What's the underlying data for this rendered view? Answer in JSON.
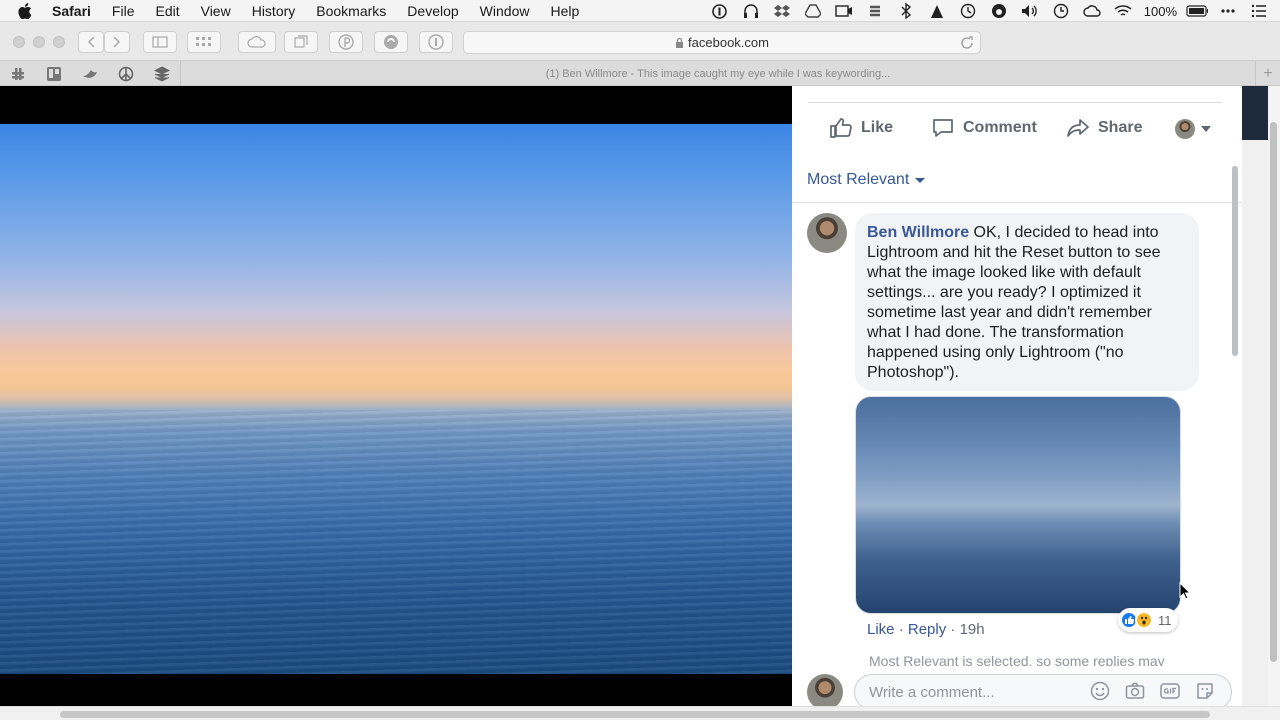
{
  "menubar": {
    "app": "Safari",
    "items": [
      "File",
      "Edit",
      "View",
      "History",
      "Bookmarks",
      "Develop",
      "Window",
      "Help"
    ],
    "battery": "100%"
  },
  "toolbar": {
    "url": "facebook.com"
  },
  "tab": {
    "title": "(1) Ben Willmore - This image caught my eye while I was keywording...",
    "new_tab": "+"
  },
  "post_actions": {
    "like": "Like",
    "comment": "Comment",
    "share": "Share"
  },
  "comments": {
    "sort": "Most Relevant",
    "author": "Ben Willmore",
    "text": " OK, I decided to head into Lightroom and hit the Reset button to see what the image looked like with default settings... are you ready? I optimized it sometime last year and didn't remember what I had done. The transformation happened using only Lightroom (\"no Photoshop\").",
    "like": "Like",
    "reply": "Reply",
    "sep": " · ",
    "time": "19h",
    "reaction_count": "11",
    "notice": "Most Relevant is selected, so some replies may",
    "write_placeholder": "Write a comment..."
  },
  "colors": {
    "fb_blue": "#385898",
    "link_blue": "#365899",
    "like_blue": "#1877f2",
    "wow_yellow": "#f7b928"
  }
}
